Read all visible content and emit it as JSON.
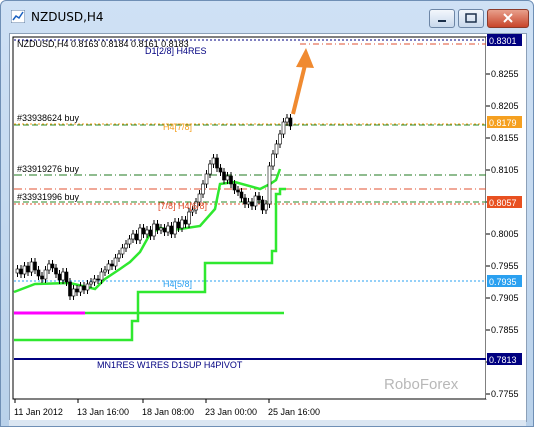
{
  "window": {
    "title": "NZDUSD,H4"
  },
  "chart": {
    "symbol_info": "NZDUSD,H4  0.8163 0.8184 0.8161 0.8183",
    "watermark": "RoboForex",
    "colors": {
      "up_arrow": "#f08a30",
      "support_green": "#2fe82f",
      "magenta": "#ff00ff",
      "navy": "#000080",
      "badge_blue": "#0000a0",
      "badge_orange": "#f5a020",
      "badge_red": "#e85020",
      "badge_lightblue": "#2aa0f0"
    },
    "price_badges": [
      {
        "price": "0.8301",
        "color": "navy"
      },
      {
        "price": "0.8179",
        "color": "orange"
      },
      {
        "price": "0.8057",
        "color": "red"
      },
      {
        "price": "0.7935",
        "color": "lightblue"
      },
      {
        "price": "0.7813",
        "color": "navy"
      }
    ],
    "y_ticks": [
      "0.8255",
      "0.8205",
      "0.8155",
      "0.8105",
      "0.8055",
      "0.8005",
      "0.7955",
      "0.7905",
      "0.7855",
      "0.7805",
      "0.7755"
    ],
    "x_ticks": [
      "11 Jan 2012",
      "13 Jan 16:00",
      "18 Jan 08:00",
      "23 Jan 00:00",
      "25 Jan 16:00"
    ],
    "order_labels": [
      "#33938624 buy",
      "#33919276 buy",
      "#33931996 buy"
    ],
    "level_labels": {
      "top": "D1[2/8] H4RES",
      "h4_78": "H4[7/8]",
      "h4_58": "H4[5/8]",
      "mid": "[7/8] H4[6/8]",
      "bottom": "MN1RES W1RES D1SUP H4PIVOT"
    }
  }
}
